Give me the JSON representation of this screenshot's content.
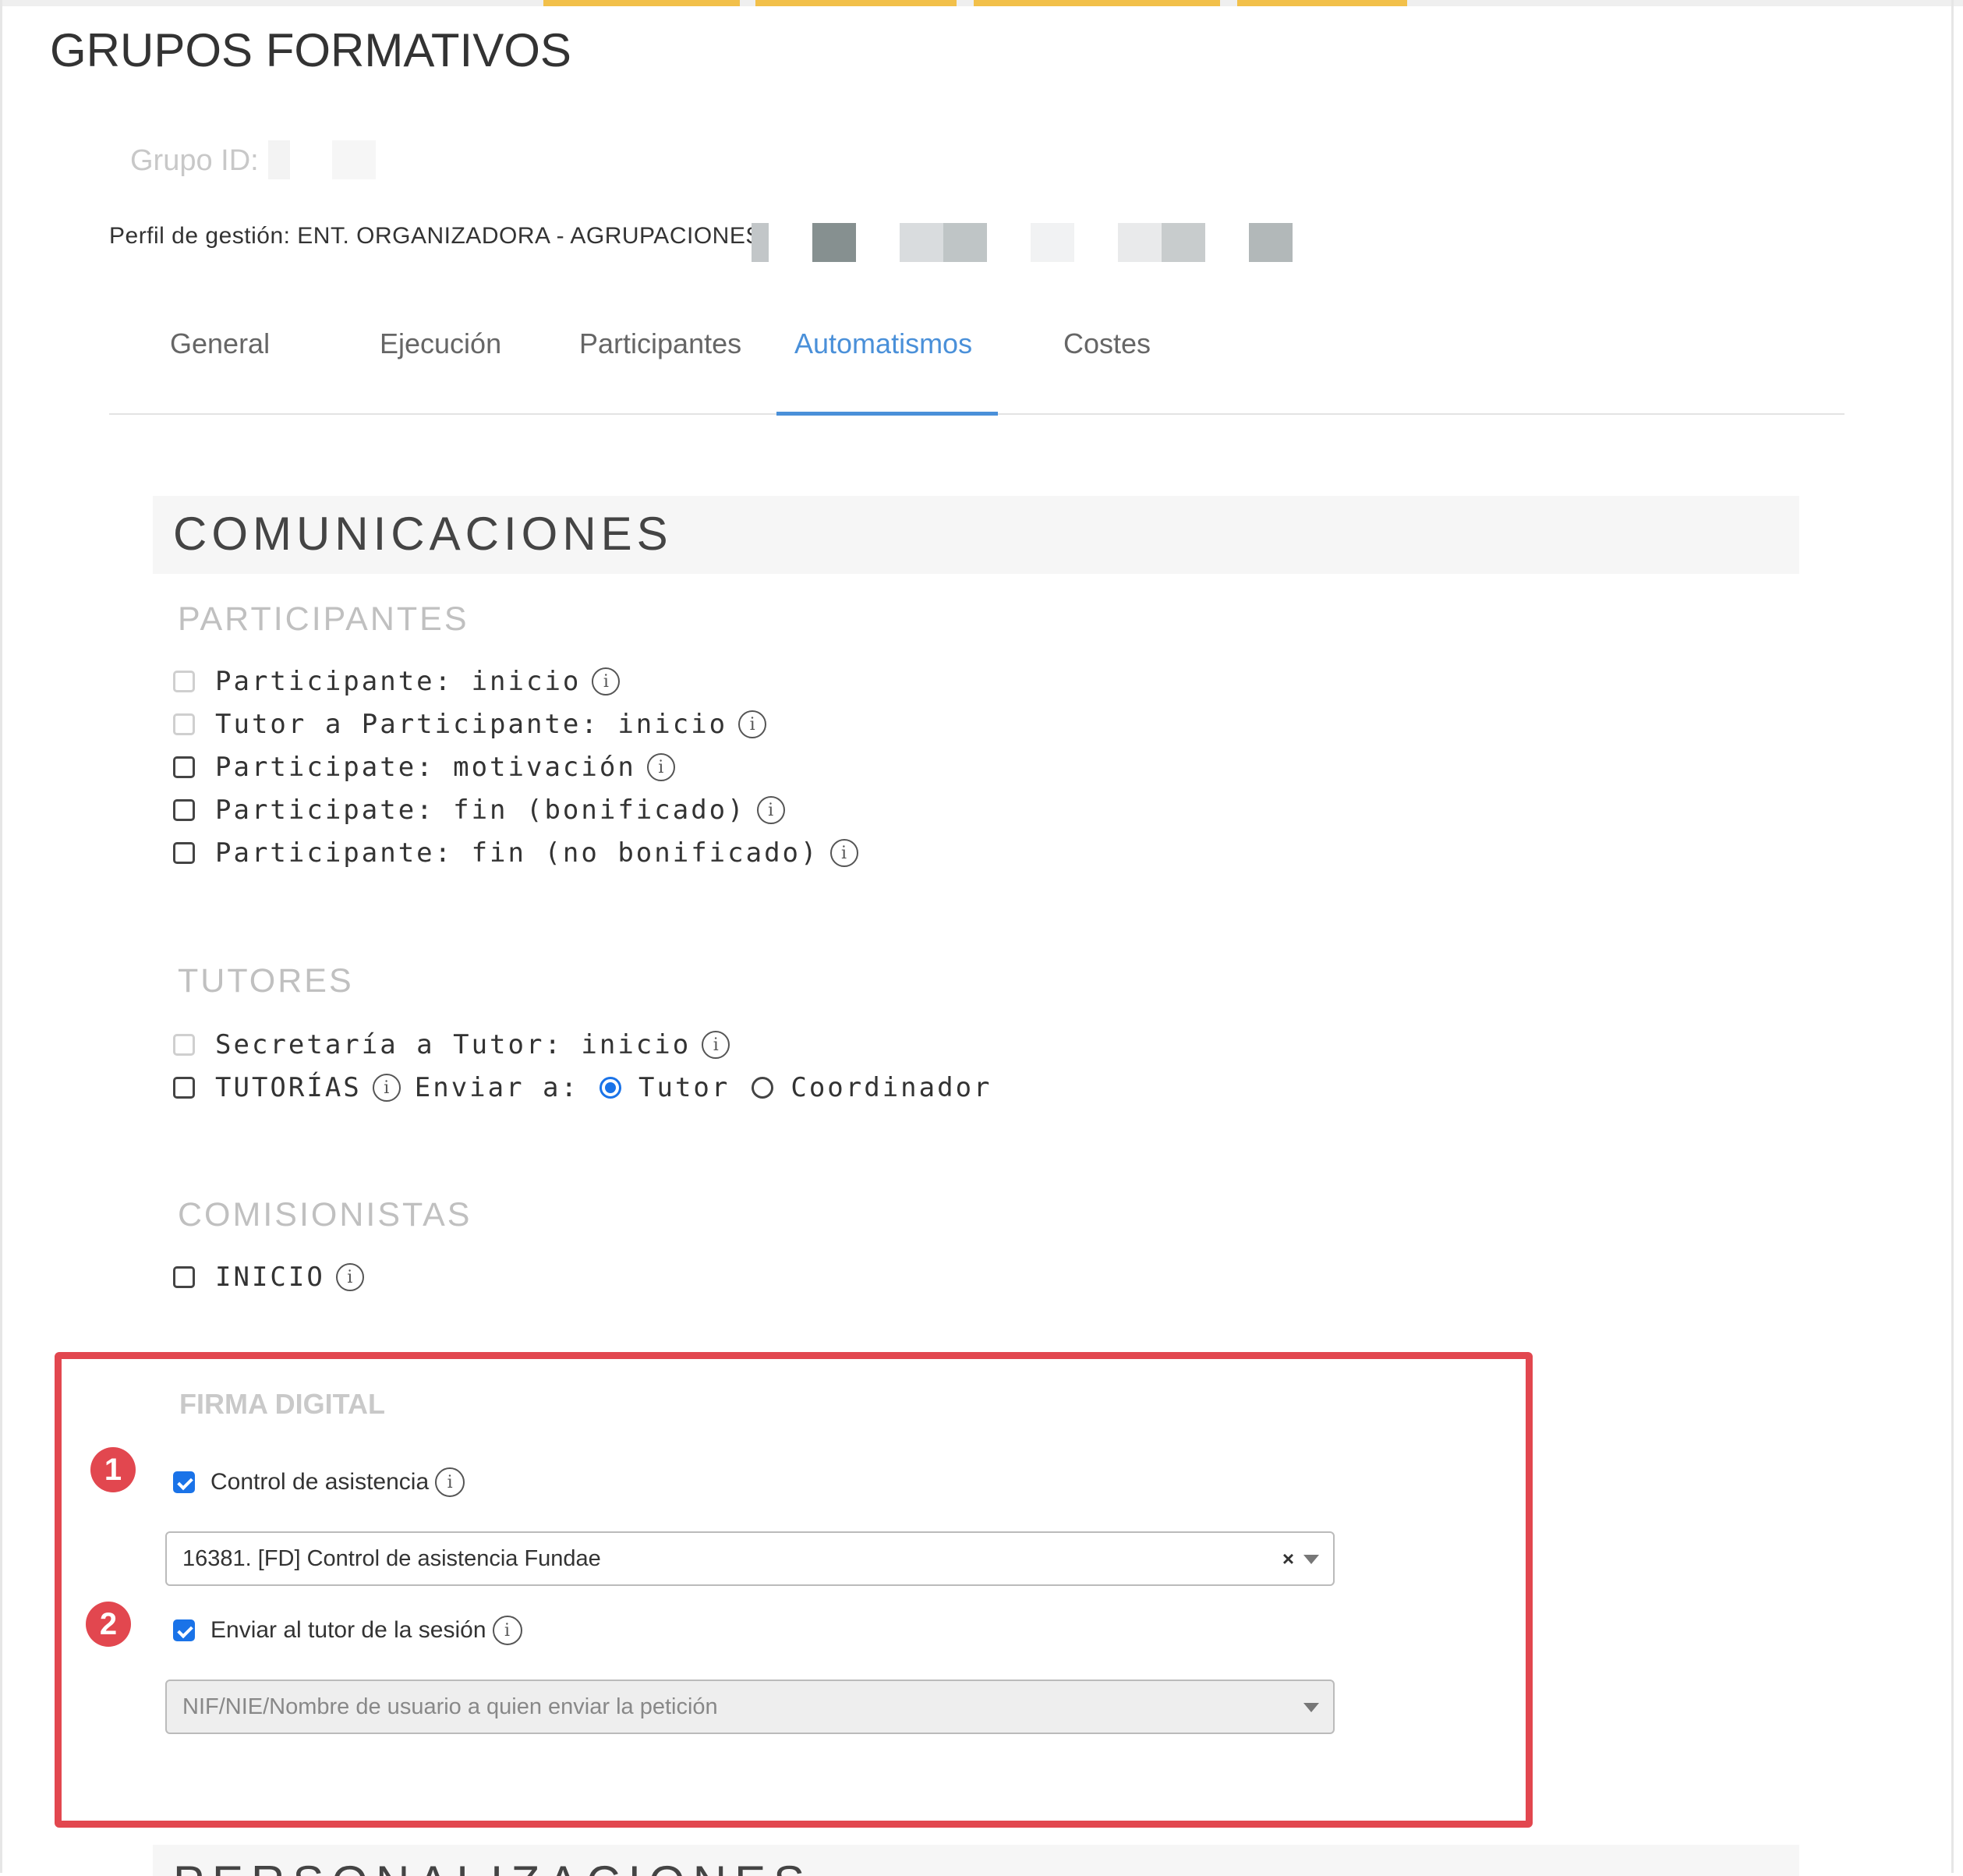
{
  "page": {
    "title": "GRUPOS FORMATIVOS"
  },
  "header": {
    "grupo_id_label": "Grupo ID:",
    "perfil_label": "Perfil de gestión: ENT. ORGANIZADORA - AGRUPACIONES"
  },
  "tabs": [
    {
      "label": "General"
    },
    {
      "label": "Ejecución"
    },
    {
      "label": "Participantes"
    },
    {
      "label": "Automatismos",
      "active": true
    },
    {
      "label": "Costes"
    }
  ],
  "comunicaciones": {
    "title": "COMUNICACIONES",
    "participantes": {
      "heading": "PARTICIPANTES",
      "items": [
        {
          "label": "Participante: inicio",
          "checked": false,
          "disabled": true
        },
        {
          "label": "Tutor a Participante: inicio",
          "checked": false,
          "disabled": true
        },
        {
          "label": "Participate: motivación",
          "checked": false,
          "disabled": false
        },
        {
          "label": "Participate: fin (bonificado)",
          "checked": false,
          "disabled": false
        },
        {
          "label": "Participante: fin (no bonificado)",
          "checked": false,
          "disabled": false
        }
      ]
    },
    "tutores": {
      "heading": "TUTORES",
      "secretaria_label": "Secretaría a Tutor: inicio",
      "tutorias_label": "TUTORÍAS",
      "enviar_label": "Enviar a:",
      "radio_tutor": "Tutor",
      "radio_coordinador": "Coordinador",
      "selected": "Tutor"
    },
    "comisionistas": {
      "heading": "COMISIONISTAS",
      "inicio_label": "INICIO"
    }
  },
  "firma_digital": {
    "heading": "FIRMA DIGITAL",
    "badge_1": "1",
    "badge_2": "2",
    "control_label": "Control de asistencia",
    "control_checked": true,
    "control_select_value": "16381. [FD] Control de asistencia Fundae",
    "clear_symbol": "×",
    "enviar_tutor_label": "Enviar al tutor de la sesión",
    "enviar_tutor_checked": true,
    "user_select_placeholder": "NIF/NIE/Nombre de usuario a quien enviar la petición"
  },
  "personalizaciones": {
    "title": "PERSONALIZACIONES"
  },
  "icons": {
    "info": "info-icon",
    "caret": "caret-down-icon",
    "clear": "clear-icon"
  },
  "colors": {
    "accent": "#4a90d9",
    "checkbox": "#1a73e8",
    "highlight": "#e2474f",
    "topbar": "#f2c04a"
  }
}
